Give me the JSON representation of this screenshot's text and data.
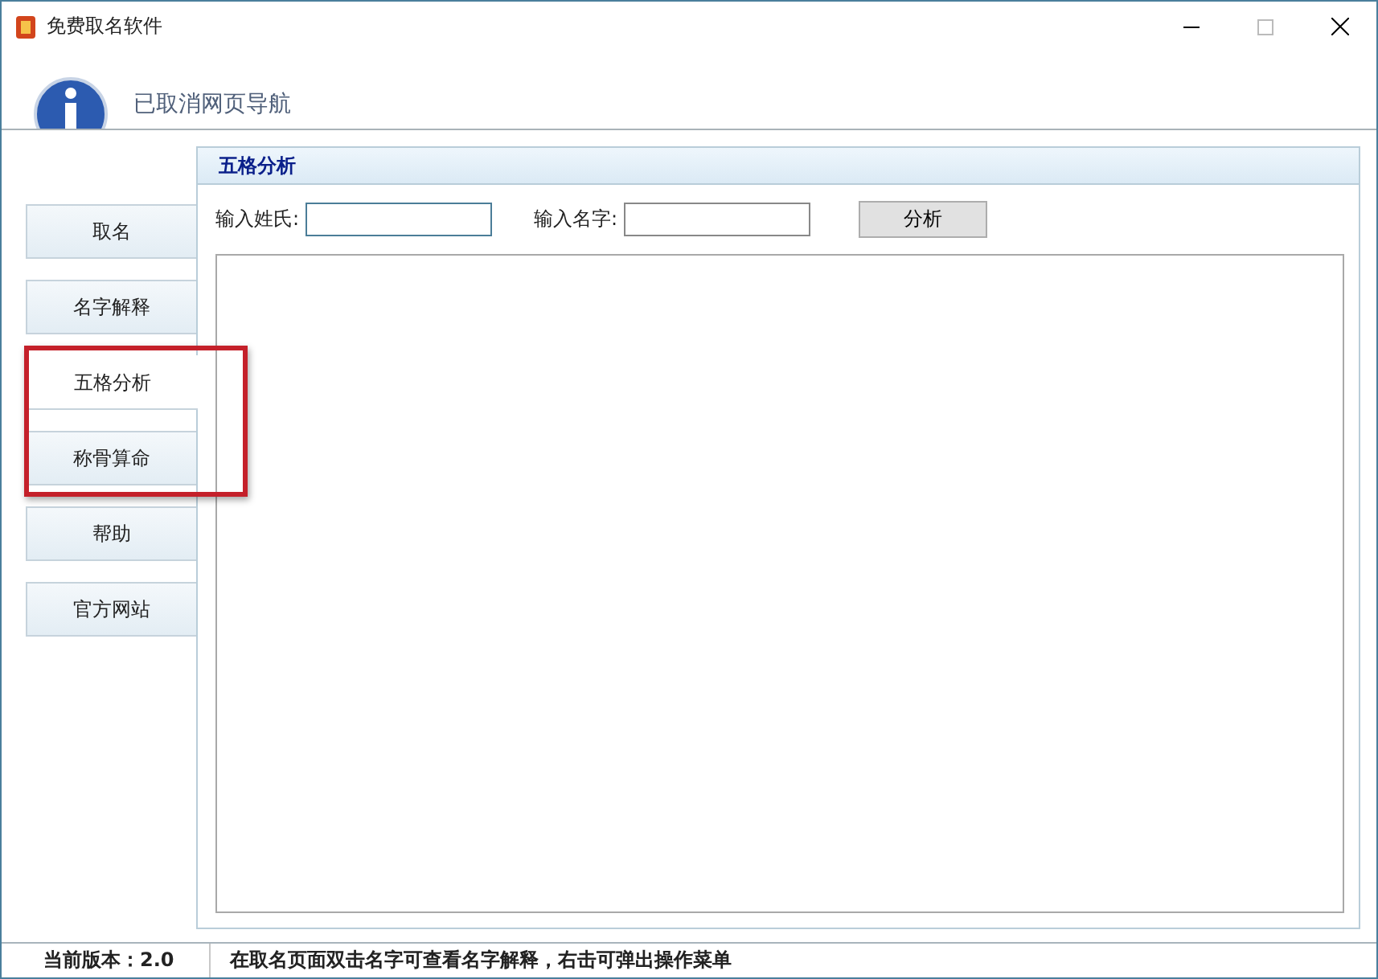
{
  "window": {
    "title": "免费取名软件"
  },
  "banner": {
    "message": "已取消网页导航"
  },
  "nav": [
    {
      "label": "取名",
      "selected": false
    },
    {
      "label": "名字解释",
      "selected": false
    },
    {
      "label": "五格分析",
      "selected": true
    },
    {
      "label": "称骨算命",
      "selected": false
    },
    {
      "label": "帮助",
      "selected": false
    },
    {
      "label": "官方网站",
      "selected": false
    }
  ],
  "panel": {
    "title": "五格分析",
    "surname_label": "输入姓氏:",
    "name_label": "输入名字:",
    "button": "分析"
  },
  "status_bar": {
    "version": "当前版本：2.0",
    "hint": "在取名页面双击名字可查看名字解释，右击可弹出操作菜单"
  }
}
